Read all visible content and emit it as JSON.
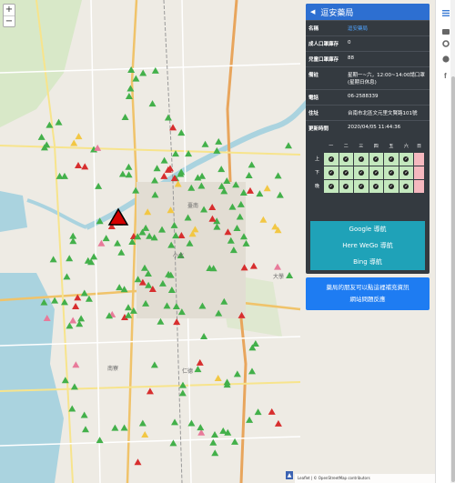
{
  "panel": {
    "title": "逗安藥局",
    "rows": [
      {
        "key": "名稱",
        "value": "逗安藥局",
        "link": true
      },
      {
        "key": "成人口罩庫存",
        "value": "0"
      },
      {
        "key": "兒童口罩庫存",
        "value": "88"
      },
      {
        "key": "備註",
        "value": "星期一~六，12:00~14:00請口罩(星期日休息)"
      },
      {
        "key": "電話",
        "value": "06-2588339"
      },
      {
        "key": "住址",
        "value": "台南市北區文元里文賢路101號"
      },
      {
        "key": "更新時間",
        "value": "2020/04/05 11:44:36"
      }
    ],
    "schedule": {
      "days": [
        "一",
        "二",
        "三",
        "四",
        "五",
        "六",
        "日"
      ],
      "periods": [
        {
          "label": "上",
          "open": [
            true,
            true,
            true,
            true,
            true,
            true,
            false
          ]
        },
        {
          "label": "下",
          "open": [
            true,
            true,
            true,
            true,
            true,
            true,
            false
          ]
        },
        {
          "label": "晚",
          "open": [
            true,
            true,
            true,
            true,
            true,
            true,
            false
          ]
        }
      ],
      "check_glyph": "✔"
    },
    "nav_buttons": [
      "Google 導航",
      "Here WeGo 導航",
      "Bing 導航"
    ]
  },
  "notice": {
    "line1": "藥局的朋友可以點這裡補充資訊",
    "line2": "網站問題反應"
  },
  "map": {
    "zoom_in": "+",
    "zoom_out": "−",
    "attribution": "Leaflet | © OpenStreetMap contributors",
    "labels": [
      "南寮",
      "仁德",
      "小北",
      "大學",
      "臺南"
    ],
    "colors": {
      "available": "#43b04a",
      "low": "#f2c744",
      "none": "#d72e2e",
      "pink": "#e87a9a",
      "selected": "#d40000"
    }
  },
  "toolbar": {
    "icons": [
      "menu-icon",
      "layers-icon",
      "gear-icon",
      "github-icon",
      "facebook-icon"
    ]
  }
}
